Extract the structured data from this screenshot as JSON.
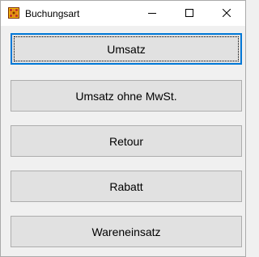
{
  "window": {
    "title": "Buchungsart",
    "icon": "app-grid-icon",
    "controls": {
      "minimize_icon": "minimize-icon",
      "maximize_icon": "maximize-icon",
      "close_icon": "close-icon"
    }
  },
  "buttons": [
    {
      "label": "Umsatz",
      "focused": true
    },
    {
      "label": "Umsatz ohne MwSt.",
      "focused": false
    },
    {
      "label": "Retour",
      "focused": false
    },
    {
      "label": "Rabatt",
      "focused": false
    },
    {
      "label": "Wareneinsatz",
      "focused": false
    }
  ],
  "colors": {
    "focus_border": "#0078d7",
    "button_face": "#e1e1e1",
    "window_bg": "#f0f0f0"
  }
}
